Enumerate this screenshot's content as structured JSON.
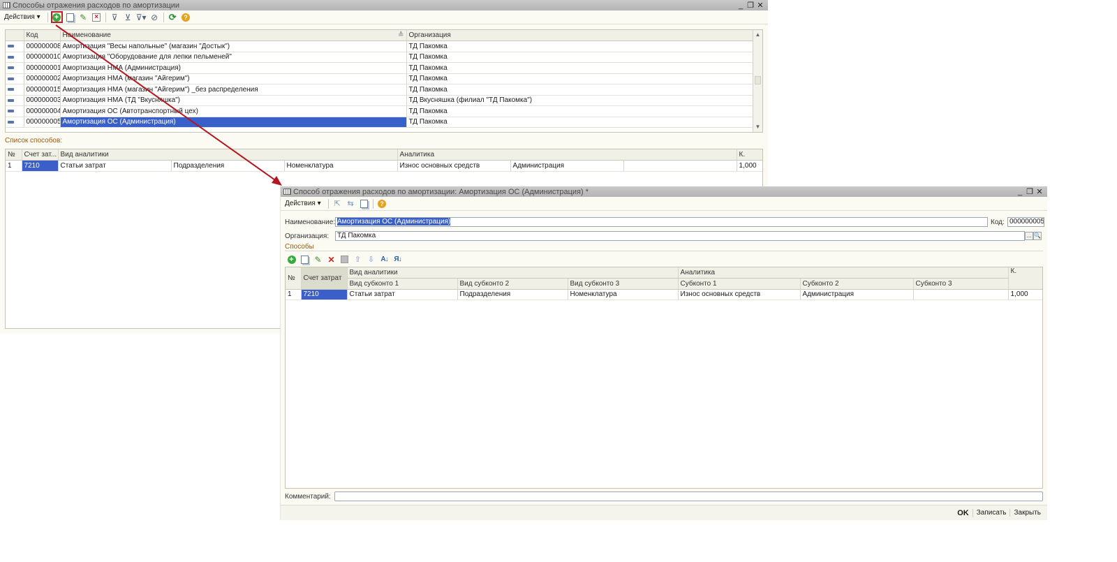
{
  "w1": {
    "title": "Способы отражения расходов по амортизации",
    "controls": [
      "_",
      "❐",
      "✕"
    ],
    "actions_label": "Действия",
    "columns": [
      "Код",
      "Наименование",
      "Организация"
    ],
    "rows": [
      {
        "code": "000000008",
        "name": "Амортизация \"Весы напольные\" (магазин \"Достык\")",
        "org": "ТД Пакомка"
      },
      {
        "code": "000000010",
        "name": "Амортизация \"Оборудование для лепки пельменей\"",
        "org": "ТД Пакомка"
      },
      {
        "code": "000000001",
        "name": "Амортизация НМА (Администрация)",
        "org": "ТД Пакомка"
      },
      {
        "code": "000000002",
        "name": "Амортизация НМА (магазин \"Айгерим\")",
        "org": "ТД Пакомка"
      },
      {
        "code": "000000015",
        "name": "Амортизация НМА (магазин \"Айгерим\") _без распределения",
        "org": "ТД Пакомка"
      },
      {
        "code": "000000003",
        "name": "Амортизация НМА (ТД \"Вкусняшка\")",
        "org": "ТД Вкусняшка (филиал \"ТД Пакомка\")"
      },
      {
        "code": "000000004",
        "name": "Амортизация ОС (Автотранспортный цех)",
        "org": "ТД Пакомка"
      },
      {
        "code": "000000005",
        "name": "Амортизация ОС (Администрация)",
        "org": "ТД Пакомка"
      }
    ],
    "sub_label": "Список способов:",
    "sub_columns": [
      "№",
      "Счет зат...",
      "Вид аналитики",
      "Аналитика",
      "К."
    ],
    "sub_rows": [
      {
        "n": "1",
        "account": "7210",
        "v1": "Статьи затрат",
        "v2": "Подразделения",
        "v3": "Номенклатура",
        "a1": "Износ основных средств",
        "a2": "Администрация",
        "a3": "",
        "k": "1,000"
      }
    ]
  },
  "w2": {
    "title": "Способ отражения расходов по амортизации: Амортизация ОС (Администрация) *",
    "controls": [
      "_",
      "❐",
      "✕"
    ],
    "actions_label": "Действия",
    "name_label": "Наименование:",
    "name_value": "Амортизация ОС (Администрация)",
    "code_label": "Код:",
    "code_value": "000000005",
    "org_label": "Организация:",
    "org_value": "ТД Пакомка",
    "org_btn1": "...",
    "org_btn2": "🔍",
    "section_label": "Способы",
    "grid_head1": [
      "№",
      "Счет затрат",
      "Вид аналитики",
      "Аналитика",
      "К."
    ],
    "grid_head2": [
      "Вид субконто 1",
      "Вид субконто 2",
      "Вид субконто 3",
      "Субконто 1",
      "Субконто 2",
      "Субконто 3"
    ],
    "grid_rows": [
      {
        "n": "1",
        "account": "7210",
        "v1": "Статьи затрат",
        "v2": "Подразделения",
        "v3": "Номенклатура",
        "s1": "Износ основных средств",
        "s2": "Администрация",
        "s3": "",
        "k": "1,000"
      }
    ],
    "comment_label": "Комментарий:",
    "comment_value": "",
    "ok_label": "OK",
    "save_label": "Записать",
    "close_label": "Закрыть"
  },
  "colors": {
    "selection": "#3a5fc8",
    "highlight_arrow": "#b3161f",
    "section_label": "#9a5a10"
  }
}
